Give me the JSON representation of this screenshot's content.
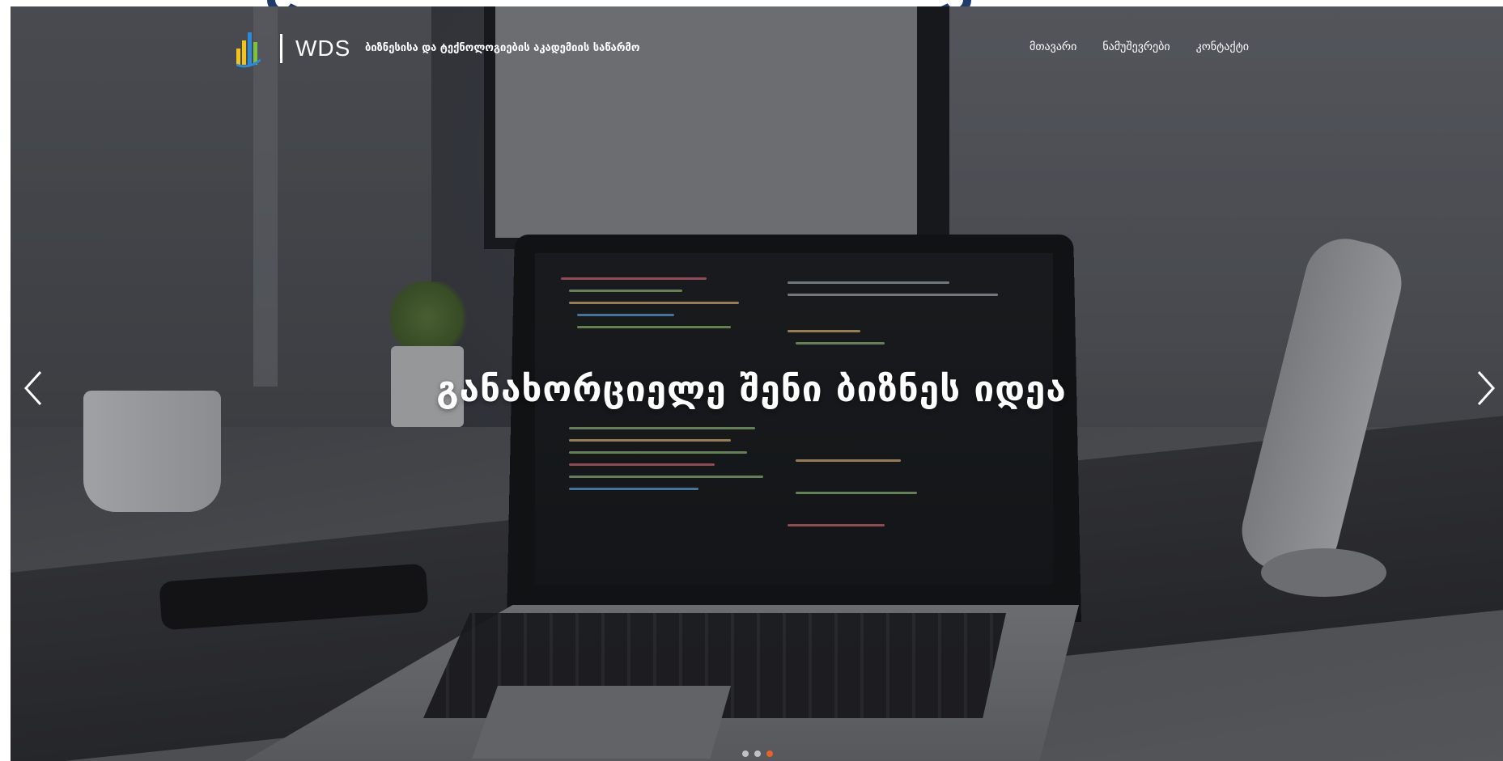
{
  "header": {
    "logo_text": "WDS",
    "tagline": "ბიზნესისა და ტექნოლოგიების აკადემიის საწარმო",
    "nav": [
      {
        "label": "მთავარი"
      },
      {
        "label": "ნამუშევრები"
      },
      {
        "label": "კონტაქტი"
      }
    ]
  },
  "hero": {
    "title": "განახორციელე შენი ბიზნეს იდეა",
    "slides_count": 3,
    "active_slide": 3
  },
  "icons": {
    "logo": "bar-chart-logo-icon",
    "prev": "chevron-left-icon",
    "next": "chevron-right-icon"
  },
  "colors": {
    "accent": "#e8612a",
    "logo_yellow": "#f2c418",
    "logo_blue": "#2b8ad6",
    "logo_green": "#7cc242",
    "top_arc": "#1f3a6b"
  }
}
